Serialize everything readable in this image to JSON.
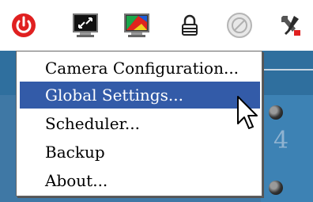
{
  "toolbar": {
    "icons": [
      "power-icon",
      "fullscreen-icon",
      "color-adjust-icon",
      "lock-icon",
      "disabled-circle-icon",
      "tools-icon"
    ]
  },
  "menu": {
    "items": [
      {
        "label": "Camera Configuration..."
      },
      {
        "label": "Global Settings...",
        "selected": true
      },
      {
        "label": "Scheduler..."
      },
      {
        "label": "Backup"
      },
      {
        "label": "About..."
      }
    ]
  },
  "panel": {
    "digit": "4"
  },
  "colors": {
    "selection": "#335ba8",
    "panel_bg": "#3f78a5",
    "power_red": "#e02020"
  }
}
